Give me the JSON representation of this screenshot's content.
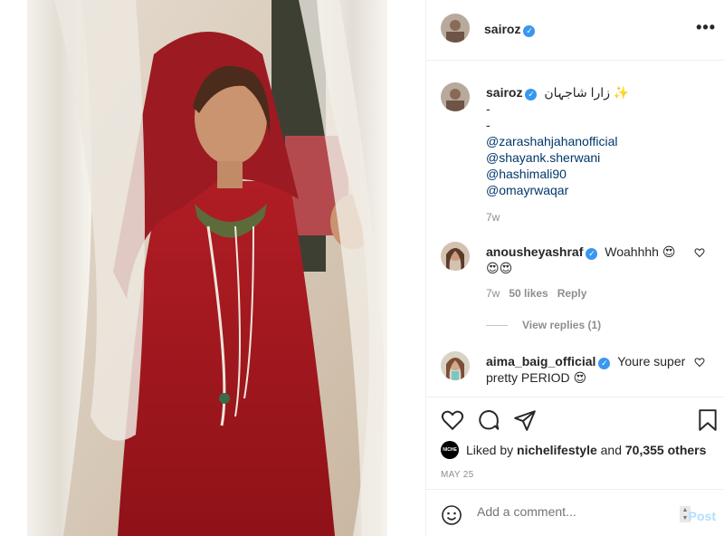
{
  "post": {
    "author": "sairoz",
    "caption_line": "زارا شاجہان ✨",
    "caption_dashes": [
      "-",
      "-"
    ],
    "mentions": [
      "@zarashahjahanofficial",
      "@shayank.sherwani",
      "@hashimali90",
      "@omayrwaqar"
    ],
    "time": "7w"
  },
  "header": {
    "more_label": "•••"
  },
  "comments": [
    {
      "user": "anousheyashraf",
      "text": "Woahhhh 😍",
      "text2": "😍😍",
      "time": "7w",
      "likes": "50 likes",
      "reply": "Reply"
    },
    {
      "user": "aima_baig_official",
      "text": "Youre super pretty PERIOD 😍"
    }
  ],
  "view_replies": "View replies (1)",
  "likes": {
    "prefix": "Liked by",
    "user": "nichelifestyle",
    "joiner": "and",
    "count": "70,355 others",
    "badge": "NICHE"
  },
  "date": "MAY 25",
  "add_comment": {
    "placeholder": "Add a comment...",
    "post_label": "Post"
  },
  "colors": {
    "link": "#00376b",
    "verified": "#3897f0",
    "muted": "#8e8e8e",
    "dress": "#a3171e"
  }
}
